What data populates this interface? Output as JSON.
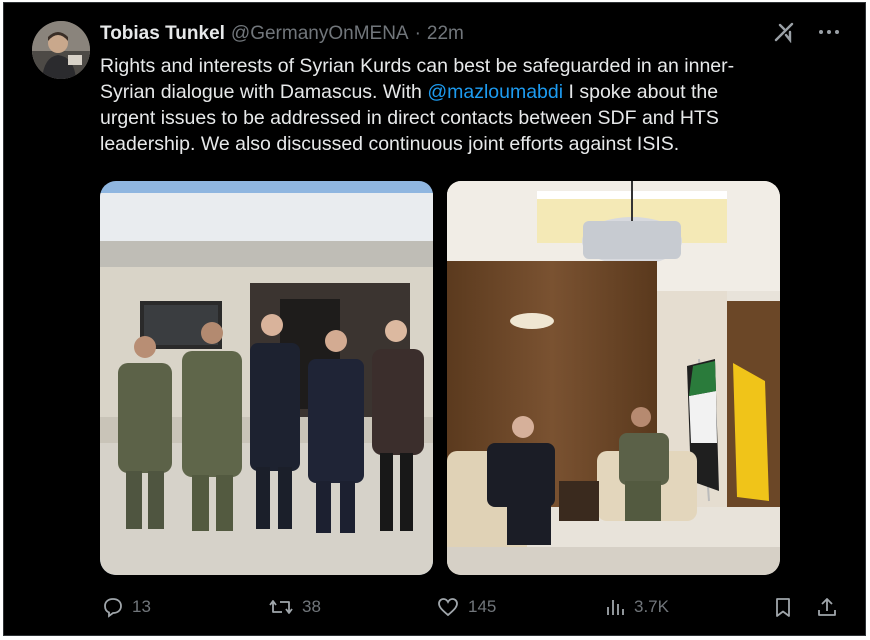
{
  "tweet": {
    "author_name": "Tobias Tunkel",
    "handle": "@GermanyOnMENA",
    "separator": "·",
    "time": "22m",
    "text_before": "Rights and interests of Syrian Kurds can best be safeguarded in an inner-\nSyrian dialogue with Damascus. With ",
    "mention": "@mazloumabdi",
    "text_after": " I spoke about the\nurgent issues to be addressed in direct contacts between SDF and HTS\nleadership. We also discussed continuous joint efforts against ISIS."
  },
  "actions": {
    "replies": "13",
    "reposts": "38",
    "likes": "145",
    "views": "3.7K"
  },
  "colors": {
    "background": "#000000",
    "text": "#e7e9ea",
    "muted": "#71767b",
    "link": "#1d9bf0"
  },
  "icons": [
    "grok-icon",
    "more-icon",
    "reply-icon",
    "repost-icon",
    "like-icon",
    "views-icon",
    "bookmark-icon",
    "share-icon"
  ]
}
